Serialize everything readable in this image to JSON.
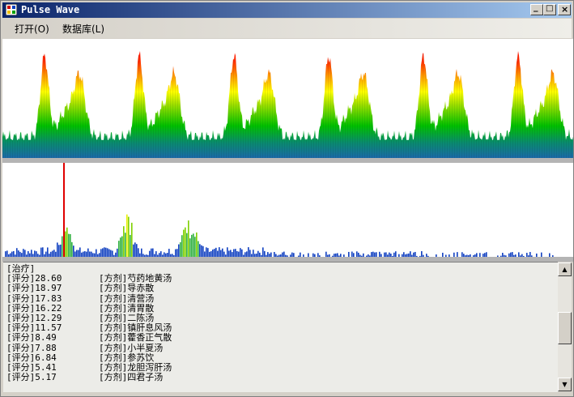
{
  "window": {
    "title": "Pulse Wave",
    "min_symbol": "_",
    "max_symbol": "□",
    "close_symbol": "×"
  },
  "menu": {
    "items": [
      {
        "label": "打开(O)"
      },
      {
        "label": "数据库(L)"
      }
    ]
  },
  "colors": {
    "peak": "#ff2000",
    "mid": "#ffff00",
    "low": "#00c000",
    "base": "#1a6aa8",
    "spectrum_peak": "#e00000",
    "spectrum_bar": "#1040c0"
  },
  "output": {
    "header": "[治疗]",
    "rows": [
      {
        "score": "[评分]28.60",
        "formula": "[方剂]芍药地黄汤"
      },
      {
        "score": "[评分]18.97",
        "formula": "[方剂]导赤散"
      },
      {
        "score": "[评分]17.83",
        "formula": "[方剂]清营汤"
      },
      {
        "score": "[评分]16.22",
        "formula": "[方剂]清胃散"
      },
      {
        "score": "[评分]12.29",
        "formula": "[方剂]二陈汤"
      },
      {
        "score": "[评分]11.57",
        "formula": "[方剂]镇肝息风汤"
      },
      {
        "score": "[评分]8.49",
        "formula": "[方剂]藿香正气散"
      },
      {
        "score": "[评分]7.88",
        "formula": "[方剂]小半夏汤"
      },
      {
        "score": "[评分]6.84",
        "formula": "[方剂]参苏饮"
      },
      {
        "score": "[评分]5.41",
        "formula": "[方剂]龙胆泻肝汤"
      },
      {
        "score": "[评分]5.17",
        "formula": "[方剂]四君子汤"
      }
    ]
  },
  "scrollbar": {
    "up_icon": "▲",
    "down_icon": "▼"
  }
}
